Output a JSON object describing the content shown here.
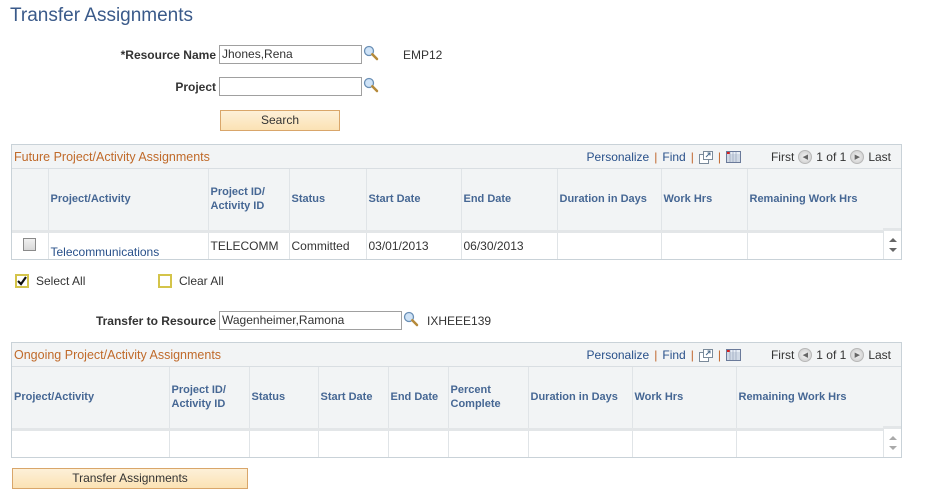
{
  "page": {
    "title": "Transfer Assignments"
  },
  "search_form": {
    "resource_name_label": "*Resource Name",
    "resource_name_value": "Jhones,Rena",
    "resource_id": "EMP12",
    "project_label": "Project",
    "project_value": "",
    "search_button": "Search"
  },
  "grid_nav": {
    "personalize": "Personalize",
    "find": "Find",
    "separator": "|",
    "first": "First",
    "page_info": "1 of 1",
    "last": "Last"
  },
  "future_grid": {
    "title": "Future Project/Activity Assignments",
    "columns": [
      "",
      "Project/Activity",
      "Project ID/ Activity ID",
      "Status",
      "Start Date",
      "End Date",
      "Duration in Days",
      "Work Hrs",
      "Remaining Work Hrs"
    ],
    "rows": [
      {
        "selected": false,
        "project_activity": "Telecommunications",
        "project_id": "TELECOMM",
        "status": "Committed",
        "start_date": "03/01/2013",
        "end_date": "06/30/2013",
        "duration_days": "",
        "work_hrs": "",
        "remaining_work_hrs": ""
      }
    ]
  },
  "select_controls": {
    "select_all": "Select All",
    "clear_all": "Clear All"
  },
  "transfer_form": {
    "transfer_to_label": "Transfer to Resource",
    "transfer_to_value": "Wagenheimer,Ramona",
    "transfer_to_id": "IXHEEE139"
  },
  "ongoing_grid": {
    "title": "Ongoing Project/Activity Assignments",
    "columns": [
      "Project/Activity",
      "Project ID/ Activity ID",
      "Status",
      "Start Date",
      "End Date",
      "Percent Complete",
      "Duration in Days",
      "Work Hrs",
      "Remaining Work Hrs"
    ],
    "rows": []
  },
  "actions": {
    "transfer_button": "Transfer Assignments"
  }
}
